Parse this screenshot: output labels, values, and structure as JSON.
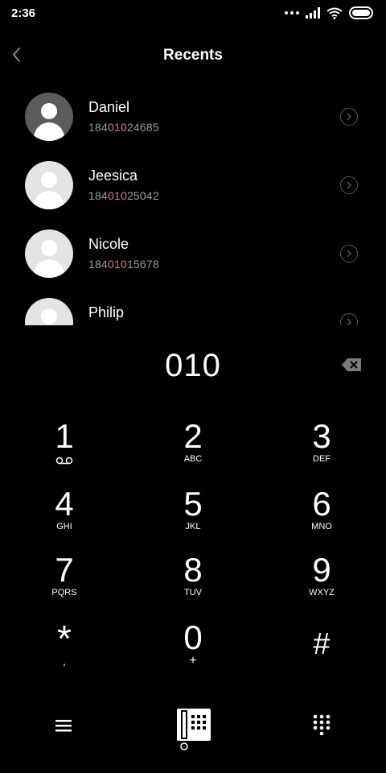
{
  "status_bar": {
    "time": "2:36"
  },
  "header": {
    "title": "Recents",
    "back_icon": "chevron-left-icon"
  },
  "recents": [
    {
      "name": "Daniel",
      "number_prefix": "184",
      "number_match": "010",
      "number_suffix": "24685",
      "avatar": "dark"
    },
    {
      "name": "Jeesica",
      "number_prefix": "184",
      "number_match": "010",
      "number_suffix": "25042",
      "avatar": "light"
    },
    {
      "name": "Nicole",
      "number_prefix": "184",
      "number_match": "010",
      "number_suffix": "15678",
      "avatar": "light"
    },
    {
      "name": "Philip",
      "number_prefix": "",
      "number_match": "",
      "number_suffix": "",
      "avatar": "light"
    }
  ],
  "dialer": {
    "entry": "010"
  },
  "keypad": {
    "k1": {
      "digit": "1",
      "letters": ""
    },
    "k2": {
      "digit": "2",
      "letters": "ABC"
    },
    "k3": {
      "digit": "3",
      "letters": "DEF"
    },
    "k4": {
      "digit": "4",
      "letters": "GHI"
    },
    "k5": {
      "digit": "5",
      "letters": "JKL"
    },
    "k6": {
      "digit": "6",
      "letters": "MNO"
    },
    "k7": {
      "digit": "7",
      "letters": "PQRS"
    },
    "k8": {
      "digit": "8",
      "letters": "TUV"
    },
    "k9": {
      "digit": "9",
      "letters": "WXYZ"
    },
    "kstar": {
      "digit": "*",
      "letters": ","
    },
    "k0": {
      "digit": "0",
      "letters": "+"
    },
    "khash": {
      "digit": "#",
      "letters": ""
    }
  },
  "colors": {
    "background": "#000000",
    "highlight": "#e3788f",
    "secondary_text": "#9a9a9a"
  }
}
